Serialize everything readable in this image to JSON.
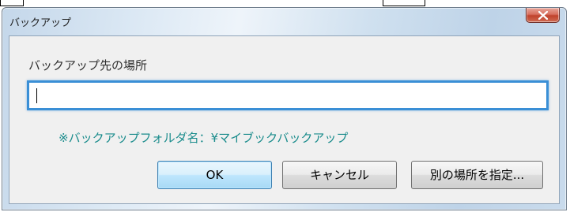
{
  "window": {
    "title": "バックアップ"
  },
  "form": {
    "destination_label": "バックアップ先の場所",
    "path_value": "",
    "note": "※バックアップフォルダ名：¥マイブックバックアップ"
  },
  "buttons": {
    "ok": "OK",
    "cancel": "キャンセル",
    "specify_other": "別の場所を指定..."
  },
  "icons": {
    "close": "close-icon"
  },
  "colors": {
    "input_focus_border": "#3a8fd6",
    "note_text": "#1a8c8c",
    "close_button": "#c0422c"
  }
}
